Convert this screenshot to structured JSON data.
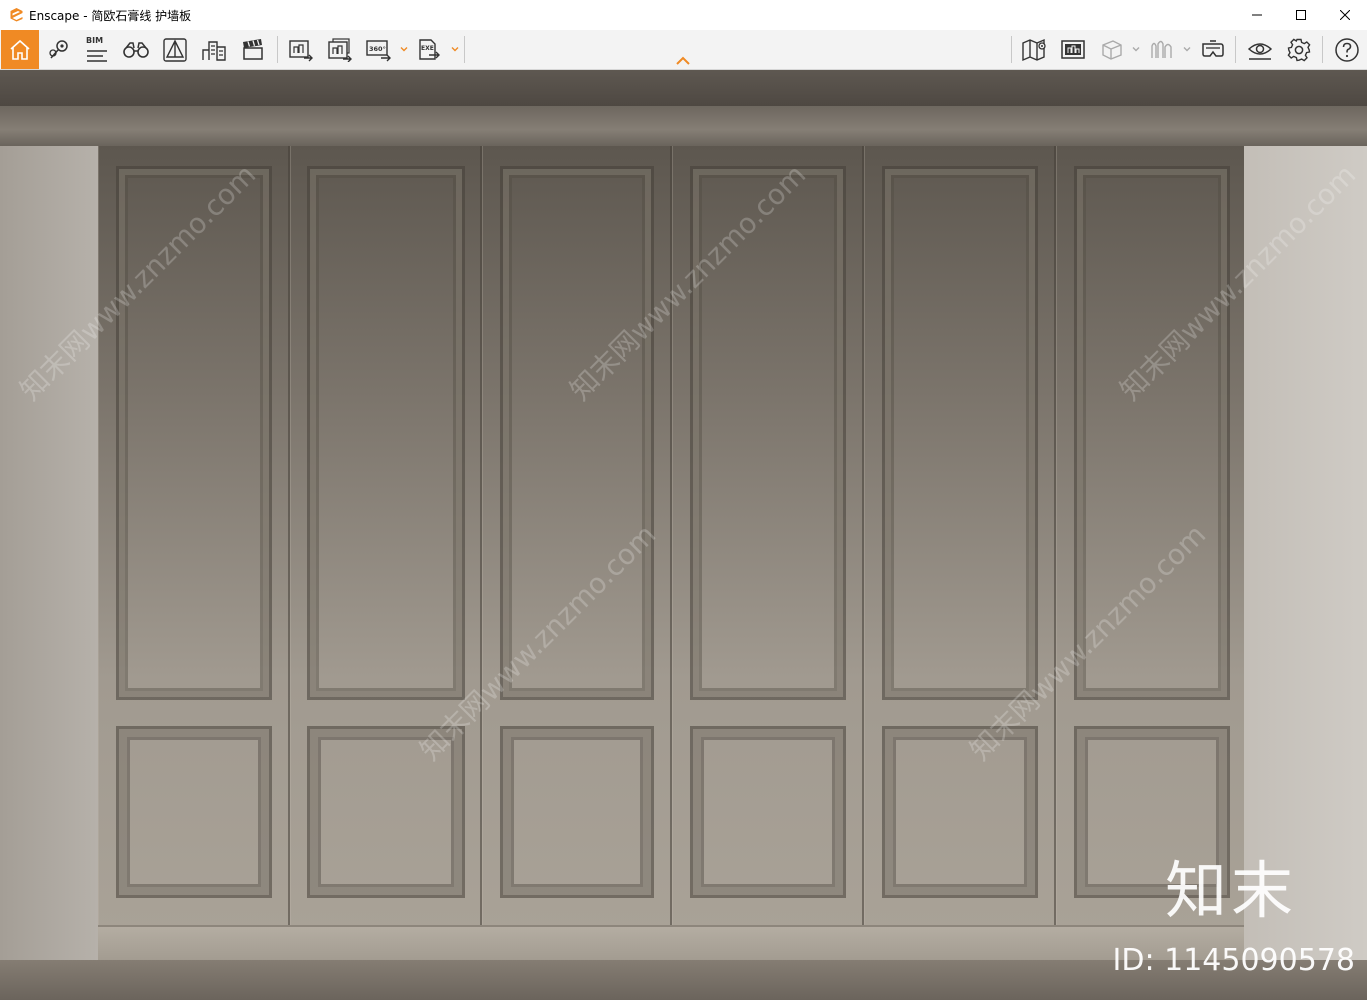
{
  "window": {
    "title": "Enscape - 简欧石膏线 护墙板",
    "controls": [
      "minimize-icon",
      "maximize-icon",
      "close-icon"
    ]
  },
  "toolbar": {
    "accent_color": "#f08a24",
    "bim_label": "BIM",
    "left_tools": [
      "home-icon",
      "location-pin-icon",
      "bim-icon",
      "binoculars-icon",
      "perspective-icon",
      "city-icon",
      "clapperboard-icon",
      "render-screenshot-icon",
      "batch-render-icon",
      "panorama-360-icon",
      "export-exe-icon"
    ],
    "panorama_label": "360°",
    "exe_label": "EXE",
    "right_tools": [
      "map-icon",
      "asset-library-icon",
      "view-cube-icon",
      "sound-wave-icon",
      "vr-headset-icon",
      "visibility-eye-icon",
      "settings-gear-icon",
      "help-icon"
    ]
  },
  "viewport": {
    "watermark_text": "知末网www.znzmo.com",
    "brand_text": "知末",
    "id_text": "ID: 1145090578"
  }
}
